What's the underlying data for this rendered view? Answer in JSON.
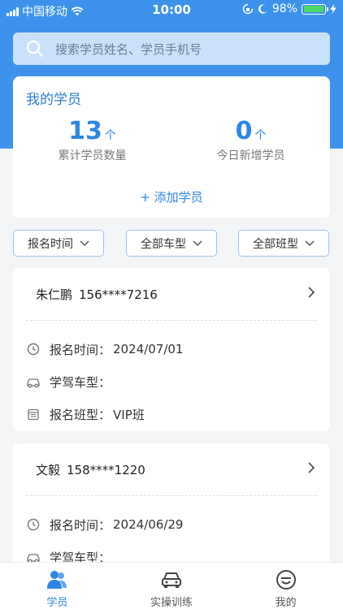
{
  "status_bar": {
    "carrier": "中国移动",
    "time": "10:00",
    "battery": "98%"
  },
  "search": {
    "placeholder": "搜索学员姓名、学员手机号"
  },
  "stats": {
    "title": "我的学员",
    "total_value": "13",
    "total_unit": "个",
    "total_label": "累计学员数量",
    "today_value": "0",
    "today_unit": "个",
    "today_label": "今日新增学员",
    "add_label": "+ 添加学员"
  },
  "filters": [
    {
      "label": "报名时间"
    },
    {
      "label": "全部车型"
    },
    {
      "label": "全部班型"
    }
  ],
  "students": [
    {
      "name": "朱仁鹏",
      "phone": "156****7216",
      "reg_label": "报名时间：",
      "reg_value": "2024/07/01",
      "car_label": "学驾车型：",
      "car_value": "",
      "class_label": "报名班型：",
      "class_value": "VIP班"
    },
    {
      "name": "文毅",
      "phone": "158****1220",
      "reg_label": "报名时间：",
      "reg_value": "2024/06/29",
      "car_label": "学驾车型：",
      "car_value": ""
    }
  ],
  "tabbar": [
    {
      "label": "学员",
      "icon": "people-icon",
      "active": true
    },
    {
      "label": "实操训练",
      "icon": "car-icon",
      "active": false
    },
    {
      "label": "我的",
      "icon": "smiley-icon",
      "active": false
    }
  ],
  "colors": {
    "primary": "#3d93ec",
    "accent_text": "#2d86e3"
  }
}
